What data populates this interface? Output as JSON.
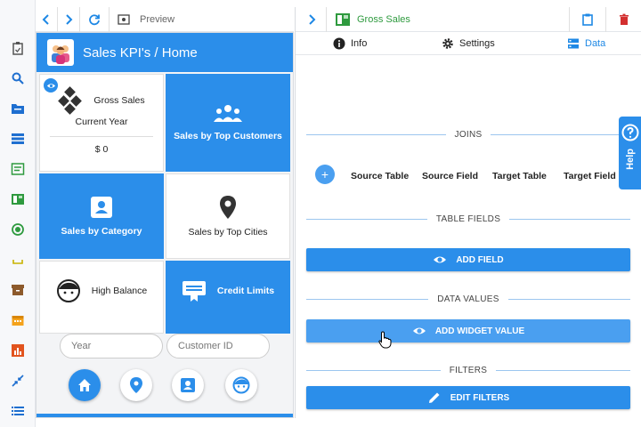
{
  "preview_toolbar": {
    "label": "Preview"
  },
  "app": {
    "title": "Sales KPI's / Home",
    "tiles": {
      "gross_sales": {
        "title": "Gross Sales",
        "subtitle": "Current Year",
        "value": "$ 0"
      },
      "sales_by_top_customers": "Sales by Top Customers",
      "sales_by_category": "Sales by Category",
      "sales_by_top_cities": "Sales by Top Cities",
      "high_balance": "High Balance",
      "credit_limits": "Credit Limits"
    },
    "filters": {
      "year_placeholder": "Year",
      "customer_id_placeholder": "Customer ID"
    }
  },
  "panel": {
    "widget_name": "Gross Sales",
    "tabs": {
      "info": "Info",
      "settings": "Settings",
      "data": "Data"
    },
    "sections": {
      "joins": "JOINS",
      "table_fields": "TABLE FIELDS",
      "data_values": "DATA VALUES",
      "filters": "FILTERS"
    },
    "joins_columns": [
      "Source Table",
      "Source Field",
      "Target Table",
      "Target Field"
    ],
    "buttons": {
      "add_field": "ADD FIELD",
      "add_widget_value": "ADD WIDGET VALUE",
      "edit_filters": "EDIT FILTERS"
    },
    "help_label": "Help"
  },
  "colors": {
    "primary": "#2b8eea",
    "green": "#2e9a3e",
    "red": "#d32f2f"
  }
}
